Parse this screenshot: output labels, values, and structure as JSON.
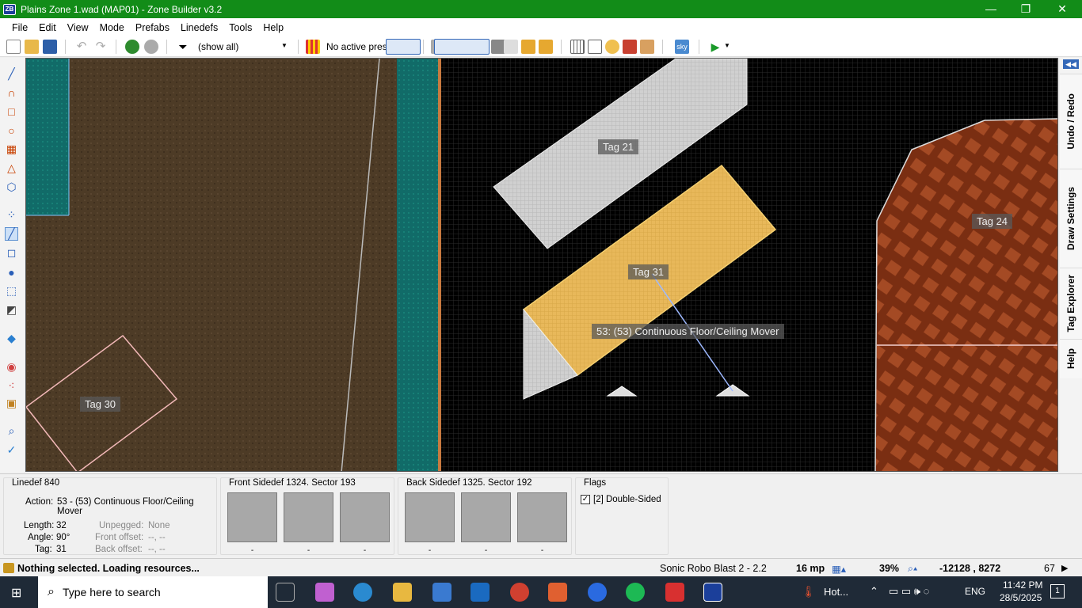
{
  "window": {
    "title": "Plains Zone 1.wad (MAP01) - Zone Builder v3.2",
    "app_badge": "ZB",
    "minimize": "—",
    "maximize": "❐",
    "close": "✕"
  },
  "menu": [
    "File",
    "Edit",
    "View",
    "Mode",
    "Prefabs",
    "Linedefs",
    "Tools",
    "Help"
  ],
  "toolbar": {
    "filter_label": "(show all)",
    "presets_label": "No active presets",
    "sky_label": "sky"
  },
  "right_tabs": [
    "Undo / Redo",
    "Draw Settings",
    "Tag Explorer",
    "Help"
  ],
  "viewport": {
    "tags": [
      "Tag 21",
      "Tag 31",
      "Tag 24",
      "Tag 30"
    ],
    "action_label": "53: (53) Continuous Floor/Ceiling Mover"
  },
  "info": {
    "linedef_title": "Linedef 840",
    "action_label": "Action:",
    "action_value": "53 - (53) Continuous Floor/Ceiling Mover",
    "length_label": "Length:",
    "length_value": "32",
    "angle_label": "Angle:",
    "angle_value": "90°",
    "tag_label": "Tag:",
    "tag_value": "31",
    "unpegged_label": "Unpegged:",
    "unpegged_value": "None",
    "front_offset_label": "Front offset:",
    "front_offset_value": "--, --",
    "back_offset_label": "Back offset:",
    "back_offset_value": "--, --",
    "front_sidedef_title": "Front Sidedef 1324. Sector 193",
    "back_sidedef_title": "Back Sidedef 1325. Sector 192",
    "texture_caption": "-",
    "flags_title": "Flags",
    "flag_item": "[2] Double-Sided"
  },
  "status": {
    "message": "Nothing selected. Loading resources...",
    "game_config": "Sonic Robo Blast 2 - 2.2",
    "grid": "16 mp",
    "zoom": "39%",
    "coords": "-12128 , 8272",
    "count": "67"
  },
  "taskbar": {
    "search_placeholder": "Type here to search",
    "weather": "Hot...",
    "language": "ENG",
    "time": "11:42 PM",
    "date": "28/5/2025",
    "notifications": "1"
  },
  "colors": {
    "titlebar": "#128c18",
    "taskbar": "#1f2a37",
    "highlight": "#f0c050"
  }
}
